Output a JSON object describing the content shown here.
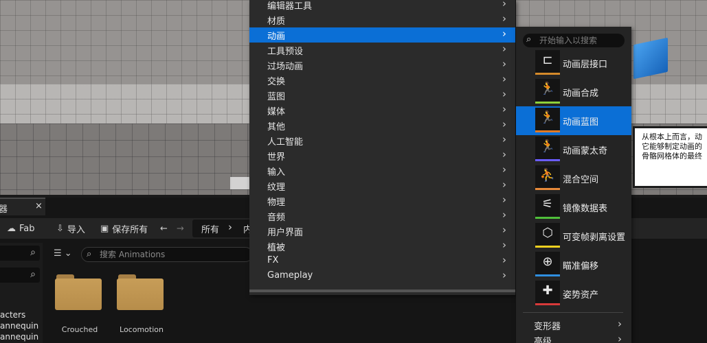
{
  "menu": {
    "items": [
      {
        "label": "编辑器工具",
        "has_submenu": true
      },
      {
        "label": "材质",
        "has_submenu": true
      },
      {
        "label": "动画",
        "has_submenu": true,
        "active": true
      },
      {
        "label": "工具预设",
        "has_submenu": true
      },
      {
        "label": "过场动画",
        "has_submenu": true
      },
      {
        "label": "交换",
        "has_submenu": true
      },
      {
        "label": "蓝图",
        "has_submenu": true
      },
      {
        "label": "媒体",
        "has_submenu": true
      },
      {
        "label": "其他",
        "has_submenu": true
      },
      {
        "label": "人工智能",
        "has_submenu": true
      },
      {
        "label": "世界",
        "has_submenu": true
      },
      {
        "label": "输入",
        "has_submenu": true
      },
      {
        "label": "纹理",
        "has_submenu": true
      },
      {
        "label": "物理",
        "has_submenu": true
      },
      {
        "label": "音频",
        "has_submenu": true
      },
      {
        "label": "用户界面",
        "has_submenu": true
      },
      {
        "label": "植被",
        "has_submenu": true
      },
      {
        "label": "FX",
        "has_submenu": true
      },
      {
        "label": "Gameplay",
        "has_submenu": true
      }
    ],
    "arrow": "›"
  },
  "submenu": {
    "search_placeholder": "开始输入以搜索",
    "items": [
      {
        "label": "动画层接口",
        "icon": "layer-interface-icon",
        "glyph": "⊏",
        "color": "#d48a2a"
      },
      {
        "label": "动画合成",
        "icon": "anim-composite-icon",
        "glyph": "🏃",
        "color": "#8fd13a"
      },
      {
        "label": "动画蓝图",
        "icon": "anim-blueprint-icon",
        "glyph": "🏃",
        "color": "#e07a26",
        "active": true
      },
      {
        "label": "动画蒙太奇",
        "icon": "anim-montage-icon",
        "glyph": "🏃",
        "color": "#6b5cff"
      },
      {
        "label": "混合空间",
        "icon": "blend-space-icon",
        "glyph": "⛹",
        "color": "#e88a3a"
      },
      {
        "label": "镜像数据表",
        "icon": "mirror-table-icon",
        "glyph": "⚟",
        "color": "#4fbf3a"
      },
      {
        "label": "可变帧剥离设置",
        "icon": "frame-stripping-icon",
        "glyph": "⬡",
        "color": "#f0d020"
      },
      {
        "label": "瞄准偏移",
        "icon": "aim-offset-icon",
        "glyph": "⊕",
        "color": "#2f8fe0"
      },
      {
        "label": "姿势资产",
        "icon": "pose-asset-icon",
        "glyph": "✚",
        "color": "#d83a3a"
      }
    ],
    "categories": [
      {
        "label": "变形器"
      },
      {
        "label": "高级"
      }
    ]
  },
  "tooltip": {
    "lines": [
      "从根本上而言，动",
      "它能够制定动画的",
      "骨骼网格体的最终"
    ]
  },
  "browser": {
    "tab_label": "器",
    "close": "×",
    "toolbar": {
      "fab_label": "Fab",
      "import_label": "导入",
      "save_all_label": "保存所有",
      "back_icon": "←",
      "forward_icon": "→",
      "crumb_all": "所有",
      "crumb_sep": "›",
      "crumb_next": "内"
    },
    "tree_items": [
      "acters",
      "annequin",
      "annequin"
    ],
    "asset_search_placeholder": "搜索 Animations",
    "folders": [
      {
        "label": "Crouched"
      },
      {
        "label": "Locomotion"
      }
    ]
  }
}
